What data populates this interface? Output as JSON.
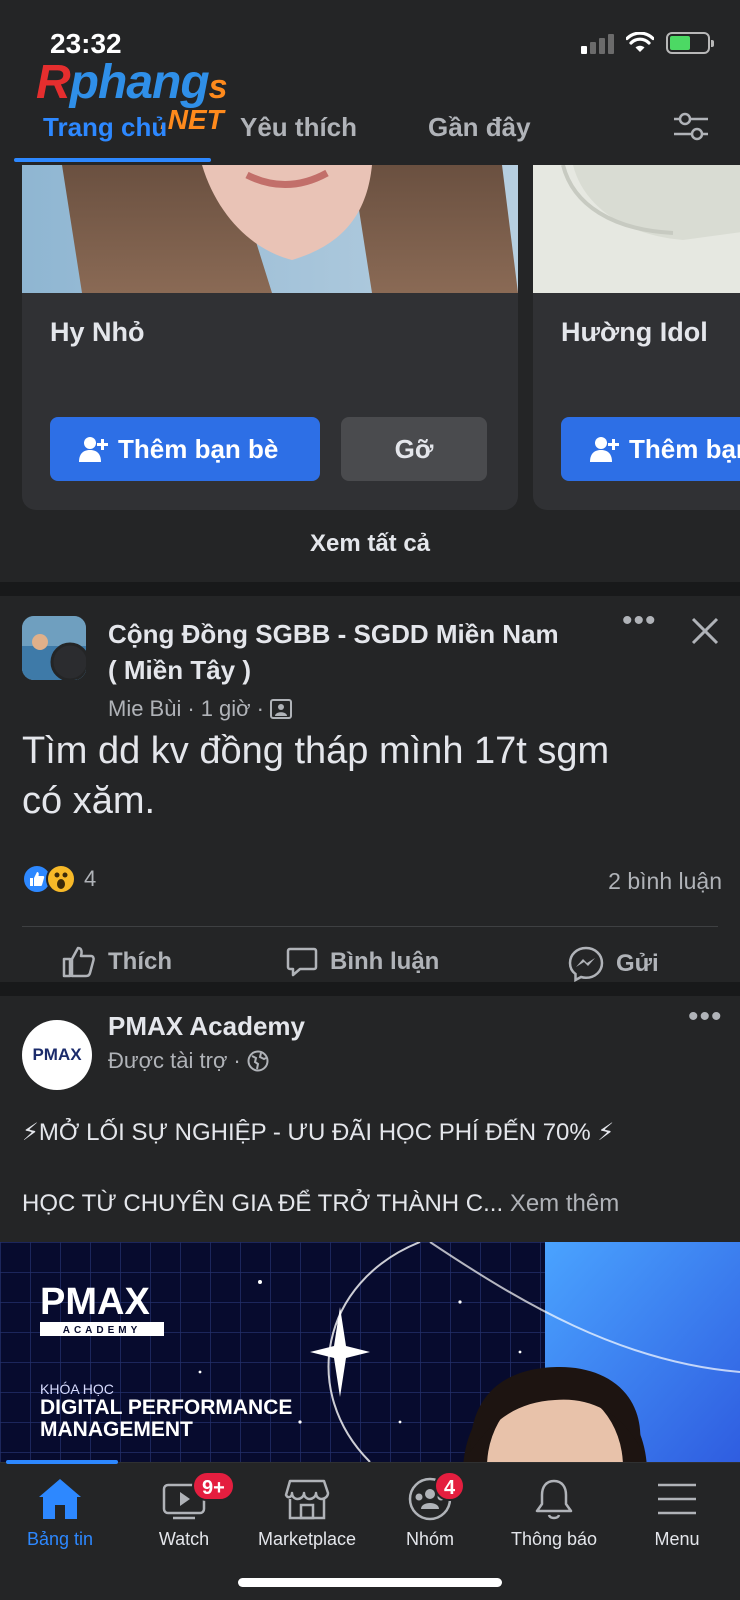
{
  "status_bar": {
    "time": "23:32"
  },
  "watermark": {
    "part1": "R",
    "part2": "phang",
    "part3": "s",
    "net": ".NET"
  },
  "tabs": [
    {
      "label": "Trang chủ",
      "active": true
    },
    {
      "label": "Yêu thích",
      "active": false
    },
    {
      "label": "Gần đây",
      "active": false
    }
  ],
  "friend_suggestions": {
    "cards": [
      {
        "name": "Hy Nhỏ",
        "add_label": "Thêm bạn bè",
        "remove_label": "Gỡ"
      },
      {
        "name": "Hường Idol",
        "add_label": "Thêm bạn bè"
      }
    ],
    "see_all": "Xem tất cả"
  },
  "post1": {
    "group": "Cộng Đồng SGBB - SGDD Miền Nam",
    "group_line2": "( Miền Tây )",
    "author": "Mie Bùi",
    "time": "1 giờ",
    "text_line1": "Tìm dd kv đồng tháp mình 17t sgm",
    "text_line2": "có xăm.",
    "reaction_count": "4",
    "comments": "2 bình luận",
    "actions": {
      "like": "Thích",
      "comment": "Bình luận",
      "send": "Gửi"
    }
  },
  "post2": {
    "page": "PMAX Academy",
    "sponsored": "Được tài trợ",
    "avatar_text": "PMAX",
    "line1": "⚡MỞ LỐI SỰ NGHIỆP - ƯU ĐÃI HỌC PHÍ ĐẾN 70% ⚡",
    "line2": "HỌC TỪ CHUYÊN GIA ĐỂ TRỞ THÀNH C...",
    "see_more": "Xem thêm",
    "image": {
      "brand": "PMAX",
      "brand_sub": "ACADEMY",
      "course_prefix": "KHÓA HỌC",
      "course_line1": "DIGITAL PERFORMANCE",
      "course_line2": "MANAGEMENT"
    }
  },
  "bottom_nav": [
    {
      "label": "Bảng tin",
      "icon": "home-icon",
      "active": true
    },
    {
      "label": "Watch",
      "icon": "watch-icon",
      "badge": "9+"
    },
    {
      "label": "Marketplace",
      "icon": "marketplace-icon"
    },
    {
      "label": "Nhóm",
      "icon": "groups-icon",
      "badge": "4"
    },
    {
      "label": "Thông báo",
      "icon": "bell-icon"
    },
    {
      "label": "Menu",
      "icon": "menu-icon"
    }
  ],
  "colors": {
    "accent": "#2d88ff",
    "background": "#242526",
    "badge": "#e41e3f"
  }
}
